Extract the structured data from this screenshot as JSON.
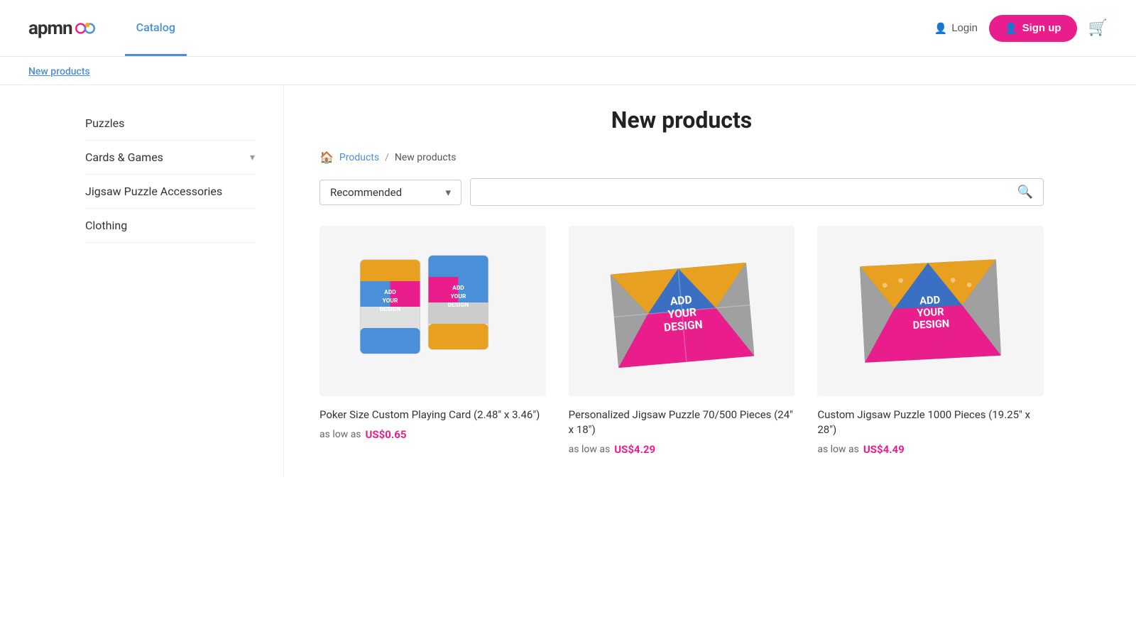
{
  "header": {
    "logo_text": "apmn",
    "nav_items": [
      {
        "label": "Catalog",
        "active": true
      }
    ],
    "login_label": "Login",
    "signup_label": "Sign up"
  },
  "subnav": {
    "link_label": "New products"
  },
  "page": {
    "title": "New products"
  },
  "breadcrumb": {
    "home_icon": "🏠",
    "products_label": "Products",
    "separator": "/",
    "current": "New products"
  },
  "filter": {
    "sort_label": "Recommended",
    "sort_arrow": "▾",
    "search_placeholder": ""
  },
  "sidebar": {
    "items": [
      {
        "label": "Puzzles",
        "has_chevron": false
      },
      {
        "label": "Cards & Games",
        "has_chevron": true
      },
      {
        "label": "Jigsaw Puzzle Accessories",
        "has_chevron": false
      },
      {
        "label": "Clothing",
        "has_chevron": false
      }
    ]
  },
  "products": [
    {
      "name": "Poker Size Custom Playing Card (2.48\" x 3.46\")",
      "price_prefix": "as low as",
      "price": "US$0.65",
      "type": "cards"
    },
    {
      "name": "Personalized Jigsaw Puzzle 70/500 Pieces (24\" x 18\")",
      "price_prefix": "as low as",
      "price": "US$4.29",
      "type": "puzzle-small"
    },
    {
      "name": "Custom Jigsaw Puzzle 1000 Pieces (19.25\" x 28\")",
      "price_prefix": "as low as",
      "price": "US$4.49",
      "type": "puzzle-large"
    }
  ]
}
